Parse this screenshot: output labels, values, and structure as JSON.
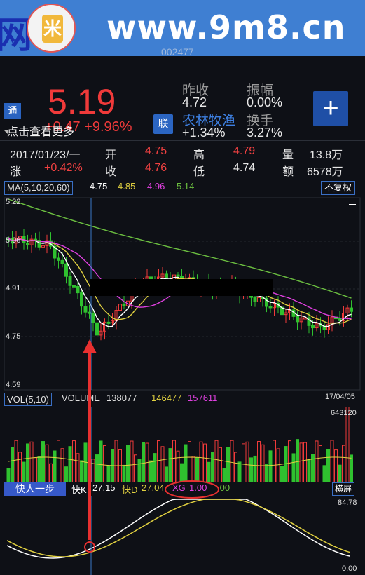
{
  "watermark": {
    "left_mark": "网",
    "url": "www.9m8.cn",
    "seal_char": "米",
    "sub": "002477"
  },
  "quote": {
    "price": "5.19",
    "tag": "通",
    "more": "点击查看更多",
    "change_ghost": "+0.47  +9.96%",
    "lian": "联",
    "prev_close_label": "昨收",
    "prev_close": "4.72",
    "amplitude_label": "振幅",
    "amplitude": "0.00%",
    "sector": "农林牧渔",
    "sector_change": "+1.34%",
    "turnover_label": "换手",
    "turnover": "3.27%",
    "plus": "+"
  },
  "stats": {
    "date": "2017/01/23/一",
    "open_label": "开",
    "open": "4.75",
    "high_label": "高",
    "high": "4.79",
    "vol_label": "量",
    "vol": "13.8万",
    "chg_label": "涨",
    "chg": "+0.42%",
    "close_label": "收",
    "close": "4.76",
    "low_label": "低",
    "low": "4.74",
    "amt_label": "额",
    "amt": "6578万"
  },
  "ma": {
    "label": "MA(5,10,20,60)",
    "v5": "4.75",
    "v10": "4.85",
    "v20": "4.96",
    "v60": "5.14",
    "restore": "不复权"
  },
  "price_axis": {
    "top": "5.22",
    "l1": "5.06",
    "l2": "4.91",
    "l3": "4.75",
    "bottom": "4.59",
    "date_end": "17/04/05"
  },
  "vol": {
    "label": "VOL(5,10)",
    "volume_label": "VOLUME",
    "volume": "138077",
    "ma5": "146477",
    "ma10": "157611",
    "max": "643120"
  },
  "indicator": {
    "label": "快人一步",
    "k_label": "快K",
    "k": "27.15",
    "d_label": "快D",
    "d": "27.04",
    "xg_label": "XG",
    "xg": "1.00",
    "extra": ".00",
    "landscape": "横屏",
    "max": "84.78",
    "min": "0.00"
  },
  "colors": {
    "up": "#f03a3a",
    "down": "#2fc12f",
    "ma5": "#ffffff",
    "ma10": "#e0d040",
    "ma20": "#e040e0",
    "ma60": "#6cc040",
    "accent": "#2b65c2"
  }
}
